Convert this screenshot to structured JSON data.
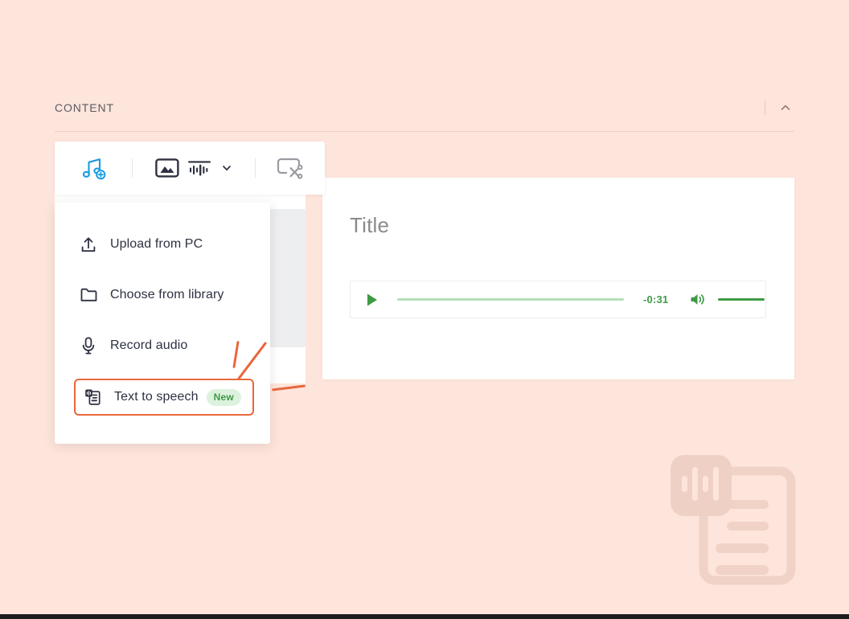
{
  "section": {
    "title": "CONTENT",
    "collapse_icon": "chevron-up-icon"
  },
  "toolbar": {
    "items": [
      {
        "name": "add-music-icon",
        "label": "Add audio"
      },
      {
        "name": "image-icon",
        "label": "Image"
      },
      {
        "name": "waveform-icon",
        "label": "Audio"
      },
      {
        "name": "chevron-down-icon",
        "label": "More audio options"
      },
      {
        "name": "trim-icon",
        "label": "Trim"
      }
    ]
  },
  "menu": {
    "items": [
      {
        "id": "upload",
        "label": "Upload from PC",
        "icon": "upload-icon",
        "badge": ""
      },
      {
        "id": "library",
        "label": "Choose from library",
        "icon": "folder-icon",
        "badge": ""
      },
      {
        "id": "record",
        "label": "Record audio",
        "icon": "microphone-icon",
        "badge": ""
      },
      {
        "id": "tts",
        "label": "Text to speech",
        "icon": "text-to-speech-icon",
        "badge": "New"
      }
    ]
  },
  "card": {
    "title_placeholder": "Title",
    "player": {
      "play_icon": "play-icon",
      "time_remaining": "-0:31",
      "speaker_icon": "volume-icon"
    }
  },
  "colors": {
    "background": "#FDE5DC",
    "accent_orange": "#E8683C",
    "accent_blue": "#1A9BE0",
    "accent_green": "#3F9A45",
    "badge_green_bg": "#DDF2DE",
    "dark_ink": "#2E3142",
    "muted_gray": "#8A8A8A"
  },
  "watermark": {
    "icon": "text-to-speech-watermark-icon"
  }
}
